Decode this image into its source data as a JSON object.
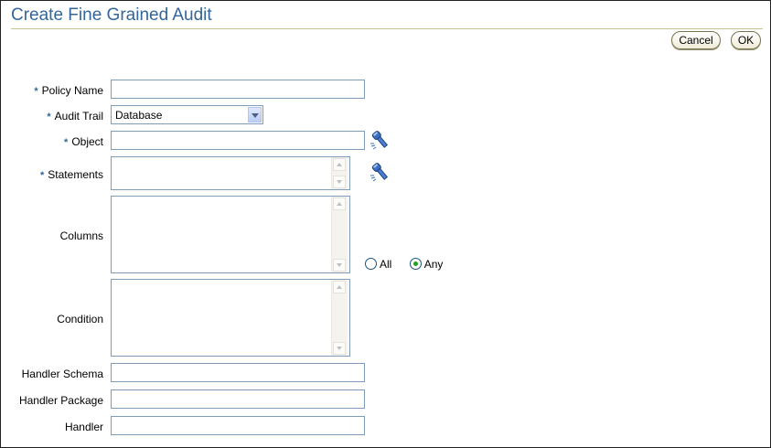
{
  "page": {
    "title": "Create Fine Grained Audit",
    "cancel_label": "Cancel",
    "ok_label": "OK"
  },
  "form": {
    "required_mark": "*",
    "policy_name": {
      "label": "Policy Name",
      "value": ""
    },
    "audit_trail": {
      "label": "Audit Trail",
      "selected": "Database"
    },
    "object": {
      "label": "Object",
      "value": ""
    },
    "statements": {
      "label": "Statements",
      "value": ""
    },
    "columns": {
      "label": "Columns",
      "value": "",
      "options": [
        {
          "label": "All",
          "selected": false
        },
        {
          "label": "Any",
          "selected": true
        }
      ]
    },
    "condition": {
      "label": "Condition",
      "value": ""
    },
    "handler_schema": {
      "label": "Handler Schema",
      "value": ""
    },
    "handler_package": {
      "label": "Handler Package",
      "value": ""
    },
    "handler": {
      "label": "Handler",
      "value": ""
    }
  },
  "icons": {
    "object_search": "flashlight-icon",
    "statements_search": "flashlight-icon"
  },
  "colors": {
    "title": "#336699",
    "required": "#336699",
    "radio_selected": "#21a121"
  }
}
